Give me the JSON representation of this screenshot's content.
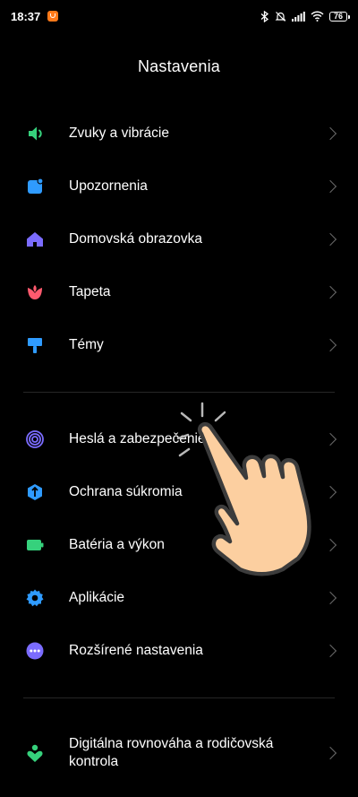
{
  "status_bar": {
    "time": "18:37",
    "battery": "76",
    "icons": [
      "bluetooth-icon",
      "silent-icon",
      "signal-icon",
      "wifi-icon",
      "battery-icon"
    ]
  },
  "header": {
    "title": "Nastavenia"
  },
  "groups": [
    {
      "items": [
        {
          "label": "Zvuky a vibrácie",
          "icon": "sound-icon",
          "color": "#36d17c"
        },
        {
          "label": "Upozornenia",
          "icon": "notification-icon",
          "color": "#2f9bff"
        },
        {
          "label": "Domovská obrazovka",
          "icon": "home-icon",
          "color": "#7b6cff"
        },
        {
          "label": "Tapeta",
          "icon": "tulip-icon",
          "color": "#ff5a6e"
        },
        {
          "label": "Témy",
          "icon": "paintbrush-icon",
          "color": "#2f9bff"
        }
      ]
    },
    {
      "items": [
        {
          "label": "Heslá a zabezpečenie",
          "icon": "fingerprint-icon",
          "color": "#7b6cff"
        },
        {
          "label": "Ochrana súkromia",
          "icon": "privacy-shield-icon",
          "color": "#2f9bff"
        },
        {
          "label": "Batéria a výkon",
          "icon": "battery-performance-icon",
          "color": "#36d17c"
        },
        {
          "label": "Aplikácie",
          "icon": "gear-icon",
          "color": "#2f9bff"
        },
        {
          "label": "Rozšírené nastavenia",
          "icon": "more-dots-icon",
          "color": "#7b6cff"
        }
      ]
    },
    {
      "items": [
        {
          "label": "Digitálna rovnováha a rodičovská kontrola",
          "icon": "digital-wellbeing-icon",
          "color": "#36d17c"
        }
      ]
    }
  ]
}
